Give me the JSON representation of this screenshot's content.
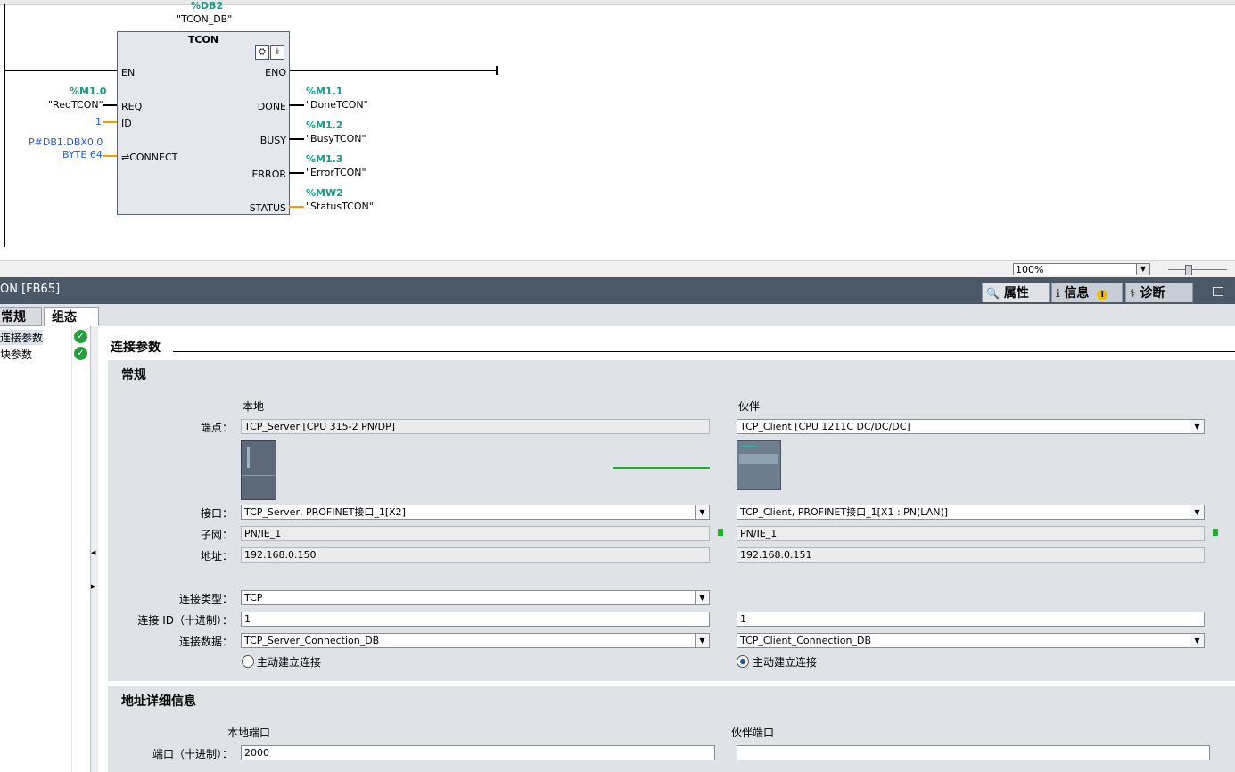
{
  "lad": {
    "db_addr": "%DB2",
    "db_name": "\"TCON_DB\"",
    "block_title": "TCON",
    "pins": {
      "en": "EN",
      "eno": "ENO",
      "req": "REQ",
      "id": "ID",
      "connect": "⇌CONNECT",
      "done": "DONE",
      "busy": "BUSY",
      "error": "ERROR",
      "status": "STATUS"
    },
    "inputs": {
      "req_addr": "%M1.0",
      "req_name": "\"ReqTCON\"",
      "id_value": "1",
      "connect_line1": "P#DB1.DBX0.0",
      "connect_line2": "BYTE 64"
    },
    "outputs": {
      "done_addr": "%M1.1",
      "done_name": "\"DoneTCON\"",
      "busy_addr": "%M1.2",
      "busy_name": "\"BusyTCON\"",
      "error_addr": "%M1.3",
      "error_name": "\"ErrorTCON\"",
      "status_addr": "%MW2",
      "status_name": "\"StatusTCON\""
    }
  },
  "zoom": {
    "value": "100%"
  },
  "inspector": {
    "title": "ON [FB65]",
    "right_tabs": [
      "属性",
      "信息",
      "诊断"
    ],
    "left_tabs": [
      "常规",
      "组态"
    ],
    "nav_items": [
      "连接参数",
      "块参数"
    ]
  },
  "content": {
    "section_title": "连接参数",
    "general": {
      "title": "常规",
      "local_header": "本地",
      "partner_header": "伙伴",
      "labels": {
        "endpoint": "端点：",
        "interface": "接口：",
        "subnet": "子网：",
        "address": "地址：",
        "conn_type": "连接类型：",
        "conn_id": "连接 ID（十进制）：",
        "conn_data": "连接数据："
      },
      "local": {
        "endpoint": "TCP_Server [CPU 315-2 PN/DP]",
        "interface": "TCP_Server, PROFINET接口_1[X2]",
        "subnet": "PN/IE_1",
        "address": "192.168.0.150",
        "conn_type": "TCP",
        "conn_id": "1",
        "conn_data": "TCP_Server_Connection_DB",
        "active_label": "主动建立连接"
      },
      "partner": {
        "endpoint": "TCP_Client [CPU 1211C DC/DC/DC]",
        "interface": "TCP_Client, PROFINET接口_1[X1 : PN(LAN)]",
        "subnet": "PN/IE_1",
        "address": "192.168.0.151",
        "conn_id": "1",
        "conn_data": "TCP_Client_Connection_DB",
        "active_label": "主动建立连接"
      }
    },
    "address_details": {
      "title": "地址详细信息",
      "local_port_header": "本地端口",
      "partner_port_header": "伙伴端口",
      "port_label": "端口（十进制）：",
      "local_port": "2000",
      "partner_port": ""
    }
  }
}
